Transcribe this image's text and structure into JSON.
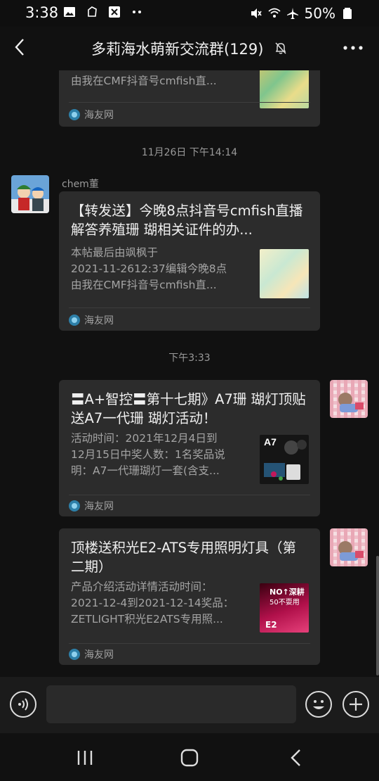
{
  "status_bar": {
    "time": "3:38",
    "battery": "50%",
    "icons": [
      "gallery-icon",
      "notification-icon",
      "app-icon",
      "more-dots-icon",
      "mute-icon",
      "wifi-icon",
      "airplane-icon",
      "battery-icon"
    ]
  },
  "header": {
    "title": "多莉海水萌新交流群(129)",
    "icons": [
      "back-icon",
      "mute-bell-icon",
      "more-icon"
    ]
  },
  "messages": [
    {
      "partial": true,
      "desc_lines": [
        "由我在CMF抖音号cmfish直..."
      ],
      "source": "海友网"
    },
    {
      "timestamp": "11月26日 下午14:14",
      "sender": "chem董",
      "title": "【转发送】今晚8点抖音号cmfish直播解答养殖珊 瑚相关证件的办...",
      "desc_lines": [
        "本帖最后由飒枫于",
        "2021-11-2612:37编辑今晚8点",
        "由我在CMF抖音号cmfish直..."
      ],
      "source": "海友网"
    },
    {
      "timestamp": "下午3:33",
      "title": "〓A+智控〓第十七期》A7珊 瑚灯顶贴送A7一代珊 瑚灯活动！",
      "desc_lines": [
        "活动时间：2021年12月4日到",
        "12月15日中奖人数：1名奖品说",
        "明：A7一代珊瑚灯一套(含支..."
      ],
      "thumb_text": "A7",
      "source": "海友网"
    },
    {
      "title": "顶楼送积光E2-ATS专用照明灯具（第二期）",
      "desc_lines": [
        "产品介绍活动详情活动时间：",
        "2021-12-4到2021-12-14奖品：",
        "ZETLIGHT积光E2ATS专用照..."
      ],
      "thumb_text": [
        "NO↑深耕",
        "50不耍用",
        "E2"
      ],
      "source": "海友网"
    }
  ],
  "input_bar": {
    "placeholder": "",
    "icons": [
      "voice-icon",
      "emoji-icon",
      "plus-icon"
    ]
  },
  "nav_bar": {
    "icons": [
      "recents-icon",
      "home-icon",
      "back-nav-icon"
    ]
  },
  "colors": {
    "background": "#111111",
    "card": "#2c2c2c",
    "text_primary": "#efefef",
    "text_secondary": "#a4a4a4"
  }
}
